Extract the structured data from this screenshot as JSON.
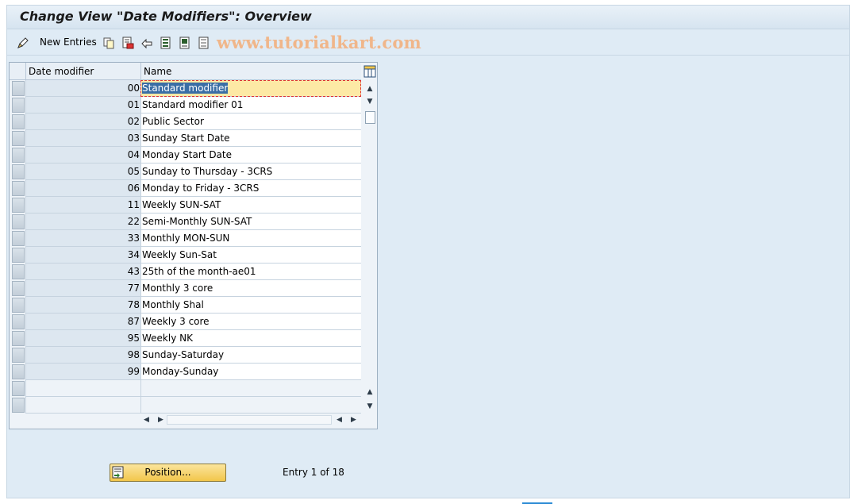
{
  "title": "Change View \"Date Modifiers\": Overview",
  "toolbar": {
    "new_entries_label": "New Entries",
    "icons": [
      "edit-pencil-icon",
      "copy-icon",
      "delete-icon",
      "undo-icon",
      "select-all-icon",
      "select-block-icon",
      "deselect-all-icon"
    ]
  },
  "watermark": "www.tutorialkart.com",
  "table": {
    "columns": [
      "Date modifier",
      "Name"
    ],
    "rows": [
      {
        "key": "00",
        "name": "Standard modifier"
      },
      {
        "key": "01",
        "name": "Standard modifier 01"
      },
      {
        "key": "02",
        "name": "Public Sector"
      },
      {
        "key": "03",
        "name": "Sunday Start Date"
      },
      {
        "key": "04",
        "name": "Monday Start Date"
      },
      {
        "key": "05",
        "name": "Sunday to Thursday - 3CRS"
      },
      {
        "key": "06",
        "name": "Monday to Friday - 3CRS"
      },
      {
        "key": "11",
        "name": "Weekly SUN-SAT"
      },
      {
        "key": "22",
        "name": "Semi-Monthly SUN-SAT"
      },
      {
        "key": "33",
        "name": "Monthly MON-SUN"
      },
      {
        "key": "34",
        "name": "Weekly Sun-Sat"
      },
      {
        "key": "43",
        "name": "25th of the month-ae01"
      },
      {
        "key": "77",
        "name": "Monthly 3 core"
      },
      {
        "key": "78",
        "name": "Monthly Shal"
      },
      {
        "key": "87",
        "name": "Weekly 3 core"
      },
      {
        "key": "95",
        "name": "Weekly NK"
      },
      {
        "key": "98",
        "name": "Sunday-Saturday"
      },
      {
        "key": "99",
        "name": "Monday-Sunday"
      }
    ],
    "empty_rows": 2
  },
  "position_button": "Position...",
  "entry_status": "Entry 1 of 18",
  "colors": {
    "background": "#dfebf5",
    "active_cell": "#fde9a5",
    "button": "#f2c64a",
    "watermark": "#f0b68a"
  }
}
